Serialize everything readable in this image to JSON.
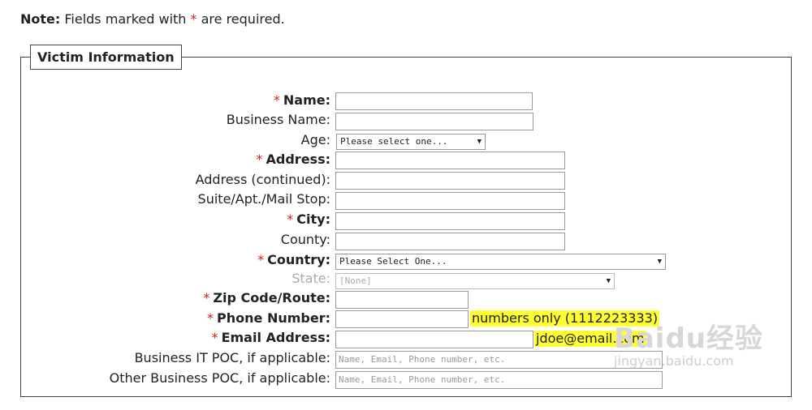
{
  "note": {
    "prefix": "Note:",
    "text_before": "Fields marked with",
    "marker": "*",
    "text_after": "are required."
  },
  "section": {
    "title": "Victim Information"
  },
  "fields": {
    "name": {
      "label": "Name:",
      "marker": "*"
    },
    "business_name": {
      "label": "Business Name:"
    },
    "age": {
      "label": "Age:",
      "selected": "Please select one..."
    },
    "address": {
      "label": "Address:",
      "marker": "*"
    },
    "address2": {
      "label": "Address (continued):"
    },
    "suite": {
      "label": "Suite/Apt./Mail Stop:"
    },
    "city": {
      "label": "City:",
      "marker": "*"
    },
    "county": {
      "label": "County:"
    },
    "country": {
      "label": "Country:",
      "marker": "*",
      "selected": "Please Select One..."
    },
    "state": {
      "label": "State:",
      "selected": "[None]"
    },
    "zip": {
      "label": "Zip Code/Route:",
      "marker": "*"
    },
    "phone": {
      "label": "Phone Number:",
      "marker": "*",
      "hint": "numbers only (1112223333)"
    },
    "email": {
      "label": "Email Address:",
      "marker": "*",
      "hint": "jdoe@email.com"
    },
    "it_poc": {
      "label": "Business IT POC, if applicable:",
      "placeholder": "Name, Email, Phone number, etc."
    },
    "other_poc": {
      "label": "Other Business POC, if applicable:",
      "placeholder": "Name, Email, Phone number, etc."
    }
  },
  "watermark": {
    "logo": "Baidu经验",
    "url": "jingyan.baidu.com"
  },
  "colors": {
    "required_marker": "#cc2222",
    "hint_highlight": "#ffff33"
  }
}
